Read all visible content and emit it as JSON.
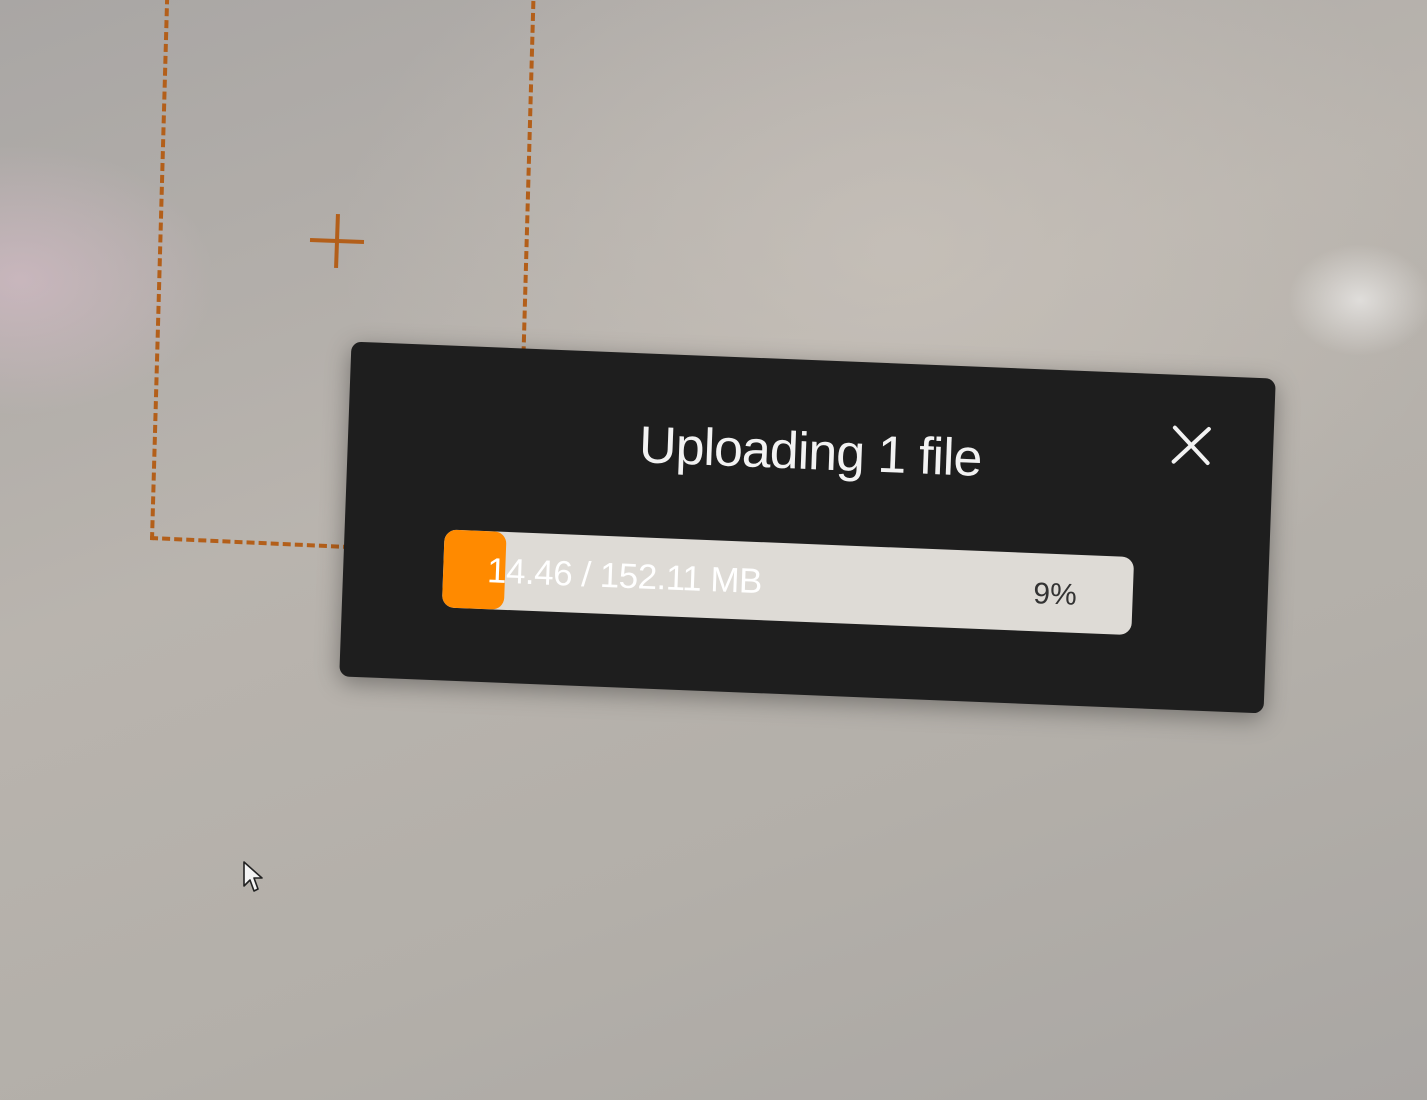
{
  "drop_zone": {
    "icon": "plus-icon",
    "border_color": "#b35f1a"
  },
  "upload_dialog": {
    "title": "Uploading 1 file",
    "close_icon": "close-icon",
    "progress": {
      "size_text": "14.46 / 152.11 MB",
      "percent_text": "9%",
      "fraction": 0.09,
      "fill_color": "#ff8a00"
    },
    "background_color": "#1e1e1e"
  },
  "cursor": {
    "icon": "arrow-cursor-icon"
  }
}
